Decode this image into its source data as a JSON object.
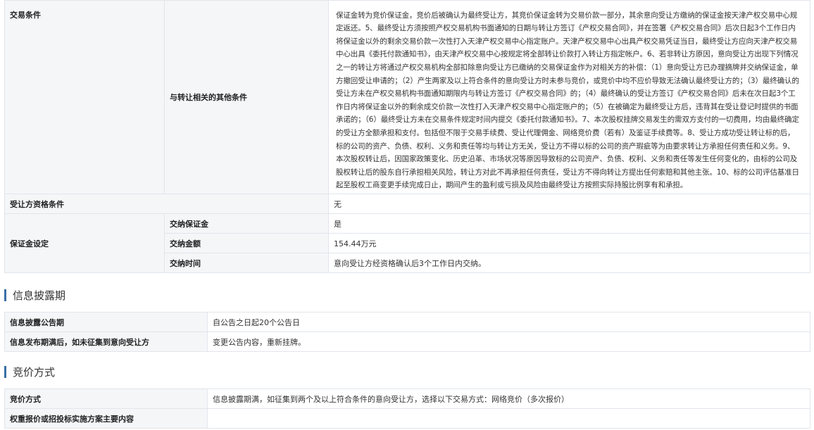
{
  "transaction": {
    "label": "交易条件",
    "sublabel": "与转让相关的其他条件",
    "text": "保证金转为竞价保证金，竞价后被确认为最终受让方，其竞价保证金转为交易价款一部分，其余意向受让方缴纳的保证金按天津产权交易中心规定返还。5、最终受让方须按照产权交易机构书面通知的日期与转让方签订《产权交易合同》，并在签署《产权交易合同》后次日起3个工作日内将保证金以外的剩余交易价款一次性打入天津产权交易中心指定账户。天津产权交易中心出具产权交易凭证当日，最终受让方应向天津产权交易中心出具《委托付款通知书》，由天津产权交易中心按规定将全部转让价款打入转让方指定帐户。6、若非转让方原因，意向受让方出现下列情况之一的转让方将通过产权交易机构全部扣除意向受让方已缴纳的交易保证金作为对相关方的补偿：（1）意向受让方已办理摘牌并交纳保证金，单方撤回受让申请的；（2）产生两家及以上符合条件的意向受让方时未参与竞价，或竞价中均不应价导致无法确认最终受让方的；（3）最终确认的受让方未在产权交易机构书面通知期限内与转让方签订《产权交易合同》的；（4）最终确认的受让方签订《产权交易合同》后未在次日起3个工作日内将保证金以外的剩余成交价款一次性打入天津产权交易中心指定账户的；（5）在被确定为最终受让方后，违背其在受让登记时提供的书面承诺的；（6）最终受让方未在交易条件规定时间内提交《委托付款通知书》。7、本次股权挂牌交易发生的需双方支付的一切费用，均由最终确定的受让方全额承担和支付。包括但不限于交易手续费、受让代理佣金、网络竞价费（若有）及鉴证手续费等。8、受让方成功受让转让标的后，标的公司的资产、负债、权利、义务和责任等均与转让方无关，受让方不得以标的公司的资产瑕疵等为由要求转让方承担任何责任和义务。9、本次股权转让后，因国家政策变化、历史沿革、市场状况等原因导致标的公司资产、负债、权利、义务和责任等发生任何变化的，由标的公司及股权转让后的股东自行承担相关风险，转让方对此不再承担任何责任，受让方不得向转让方提出任何索赔和其他主张。10、标的公司评估基准日起至股权工商变更手续完成日止，期间产生的盈利或亏损及风险由最终受让方按照实际持股比例享有和承担。"
  },
  "qualification": {
    "label": "受让方资格条件",
    "value": "无"
  },
  "deposit": {
    "label": "保证金设定",
    "rows": [
      {
        "label": "交纳保证金",
        "value": "是"
      },
      {
        "label": "交纳金额",
        "value": "154.44万元"
      },
      {
        "label": "交纳时间",
        "value": "意向受让方经资格确认后3个工作日内交纳。"
      }
    ]
  },
  "disclosure": {
    "title": "信息披露期",
    "rows": [
      {
        "label": "信息披露公告期",
        "value": "自公告之日起20个公告日"
      },
      {
        "label": "信息发布期满后，如未征集到意向受让方",
        "value": "变更公告内容，重新挂牌。"
      }
    ]
  },
  "bidding": {
    "title": "竞价方式",
    "rows": [
      {
        "label": "竞价方式",
        "value": "信息披露期满，如征集到两个及以上符合条件的意向受让方，选择以下交易方式：网络竞价（多次报价）"
      },
      {
        "label": "权重报价或招投标实施方案主要内容",
        "value": ""
      }
    ]
  },
  "colors": {
    "label_bg": "#f4f6f8",
    "border": "#e1e6ec",
    "accent": "#3a6fa5"
  }
}
